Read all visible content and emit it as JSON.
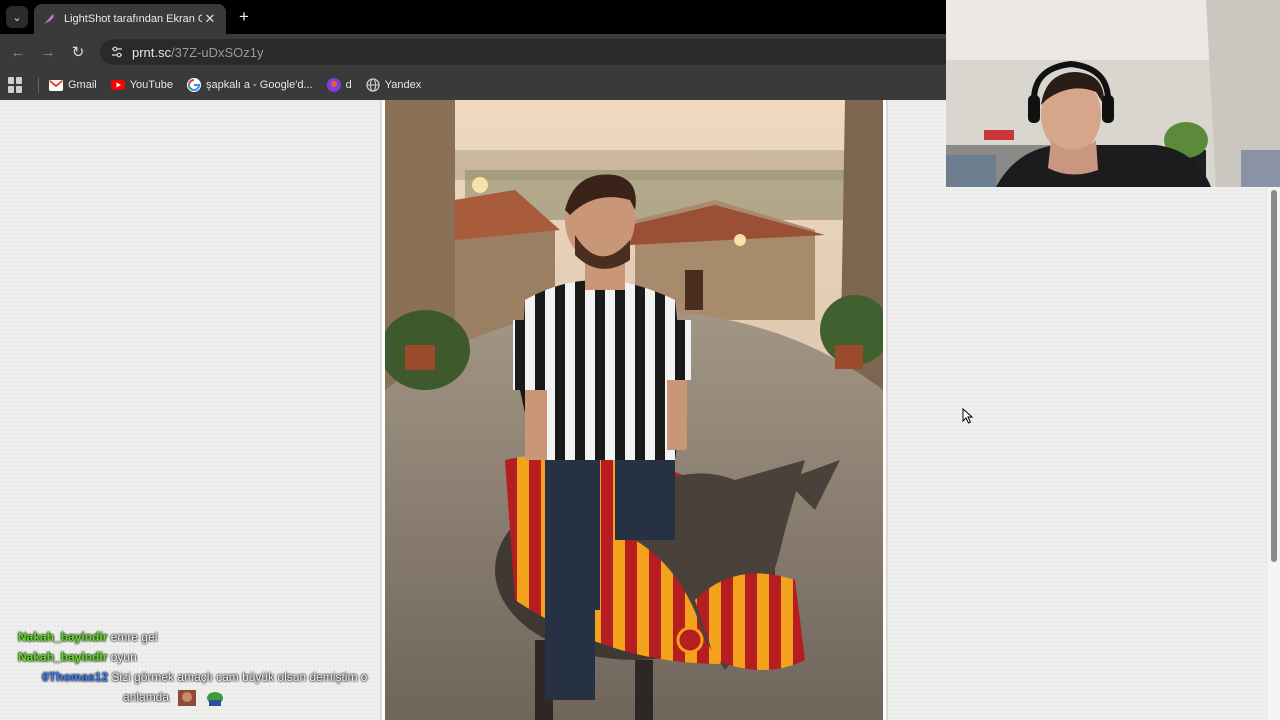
{
  "browser": {
    "tab": {
      "title": "LightShot tarafından Ekran Görü",
      "close_glyph": "✕",
      "favicon": "feather-icon"
    },
    "newtab_glyph": "+",
    "toolbar": {
      "back_glyph": "←",
      "forward_glyph": "→",
      "reload_glyph": "↻",
      "url_host": "prnt.sc",
      "url_path": "/37Z-uDxSOz1y"
    },
    "bookmarks": [
      {
        "label": "Gmail",
        "icon": "gmail-icon"
      },
      {
        "label": "YouTube",
        "icon": "youtube-icon"
      },
      {
        "label": "şapkalı a - Google'd...",
        "icon": "google-icon"
      },
      {
        "label": "d",
        "icon": "bookmark-avatar-icon"
      },
      {
        "label": "Yandex",
        "icon": "globe-icon"
      }
    ]
  },
  "chat": {
    "messages": [
      {
        "user": "Nakah_bayindir",
        "text": "emre gel"
      },
      {
        "user": "Nakah_bayindir",
        "text": "oyun"
      },
      {
        "user": "0Thomas12",
        "text": "Sizi görmek amaçlı cam büyük olsun demiştim o",
        "text2": "anlamda"
      }
    ]
  },
  "colors": {
    "chat_green": "#5ee01a",
    "chat_blue": "#3a7cff",
    "page_bg": "#efefee",
    "kit_red": "#b51d21",
    "kit_yellow": "#f2a21b"
  }
}
